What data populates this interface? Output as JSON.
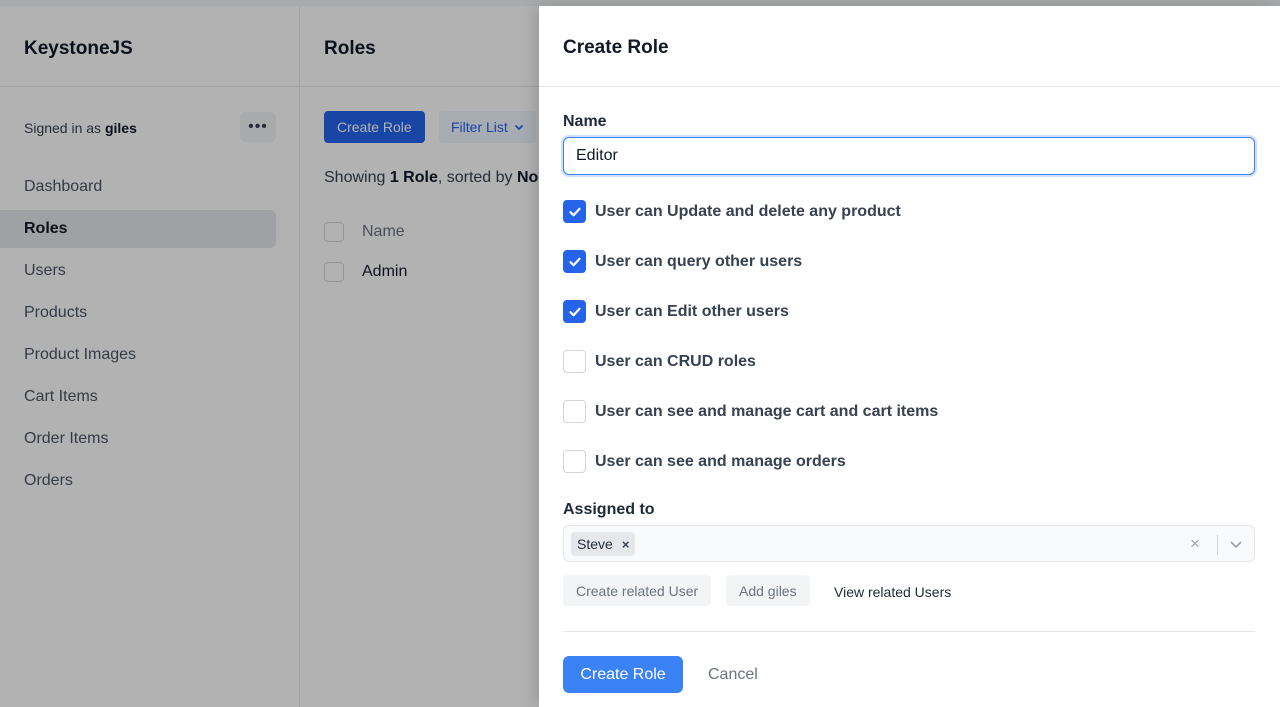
{
  "sidebar": {
    "brand": "KeystoneJS",
    "signed_in_prefix": "Signed in as",
    "signed_in_user": "giles",
    "more_label": "•••",
    "items": [
      {
        "label": "Dashboard"
      },
      {
        "label": "Roles"
      },
      {
        "label": "Users"
      },
      {
        "label": "Products"
      },
      {
        "label": "Product Images"
      },
      {
        "label": "Cart Items"
      },
      {
        "label": "Order Items"
      },
      {
        "label": "Orders"
      }
    ]
  },
  "main": {
    "title": "Roles",
    "create_label": "Create Role",
    "filter_label": "Filter List",
    "showing_prefix": "Showing",
    "showing_count": "1 Role",
    "showing_suffix": ", sorted by",
    "sorted_field": "No",
    "column_name": "Name",
    "rows": [
      {
        "name": "Admin"
      }
    ]
  },
  "drawer": {
    "title": "Create Role",
    "name_label": "Name",
    "name_value": "Editor",
    "permissions": [
      {
        "label": "User can Update and delete any product",
        "checked": true
      },
      {
        "label": "User can query other users",
        "checked": true
      },
      {
        "label": "User can Edit other users",
        "checked": true
      },
      {
        "label": "User can CRUD roles",
        "checked": false
      },
      {
        "label": "User can see and manage cart and cart items",
        "checked": false
      },
      {
        "label": "User can see and manage orders",
        "checked": false
      }
    ],
    "assigned_label": "Assigned to",
    "assigned_chip": "Steve",
    "chip_remove": "×",
    "clear_glyph": "×",
    "create_related_label": "Create related User",
    "add_user_label": "Add giles",
    "view_related_label": "View related Users",
    "submit_label": "Create Role",
    "cancel_label": "Cancel"
  },
  "colors": {
    "primary": "#2563eb",
    "primary_light": "#3b82f6",
    "overlay": "rgba(0,0,0,0.30)"
  }
}
